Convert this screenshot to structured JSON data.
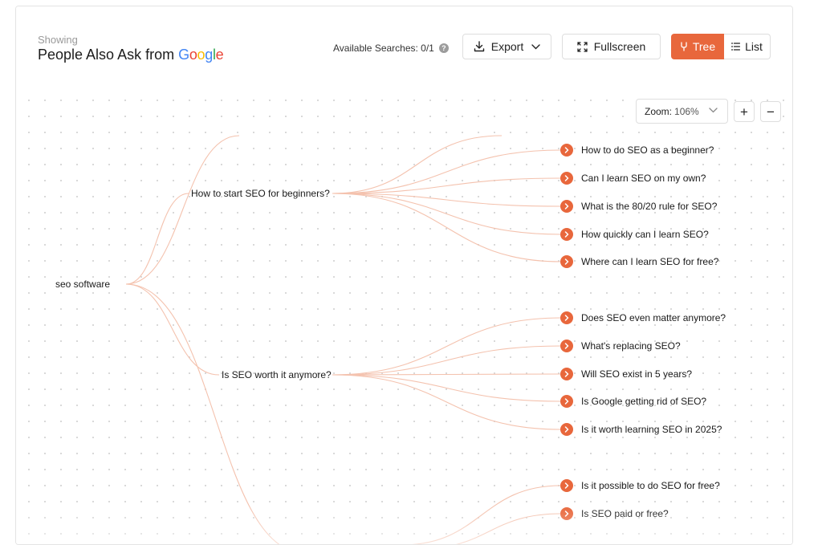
{
  "header": {
    "showing": "Showing",
    "title": "People Also Ask from",
    "google": [
      "G",
      "o",
      "o",
      "g",
      "l",
      "e"
    ],
    "available_searches": "Available Searches: 0/1",
    "help_icon": "question-circle-icon",
    "export_label": "Export",
    "fullscreen_label": "Fullscreen",
    "tree_label": "Tree",
    "list_label": "List"
  },
  "colors": {
    "accent": "#e8673c",
    "link": "#f4c2ae",
    "google": [
      "#4285F4",
      "#EA4335",
      "#FBBC05",
      "#4285F4",
      "#34A853",
      "#EA4335"
    ]
  },
  "zoom": {
    "label": "Zoom:",
    "value": "106%",
    "zoom_in": "+",
    "zoom_out": "−"
  },
  "tree": {
    "root": "seo software",
    "branches": [
      {
        "label": "How to start SEO for beginners?",
        "questions": [
          "How to do SEO as a beginner?",
          "Can I learn SEO on my own?",
          "What is the 80/20 rule for SEO?",
          "How quickly can I learn SEO?",
          "Where can I learn SEO for free?"
        ]
      },
      {
        "label": "Is SEO worth it anymore?",
        "questions": [
          "Does SEO even matter anymore?",
          "What's replacing SEO?",
          "Will SEO exist in 5 years?",
          "Is Google getting rid of SEO?",
          "Is it worth learning SEO in 2025?"
        ]
      },
      {
        "label": "",
        "questions": [
          "Is it possible to do SEO for free?",
          "Is SEO paid or free?"
        ]
      }
    ]
  }
}
